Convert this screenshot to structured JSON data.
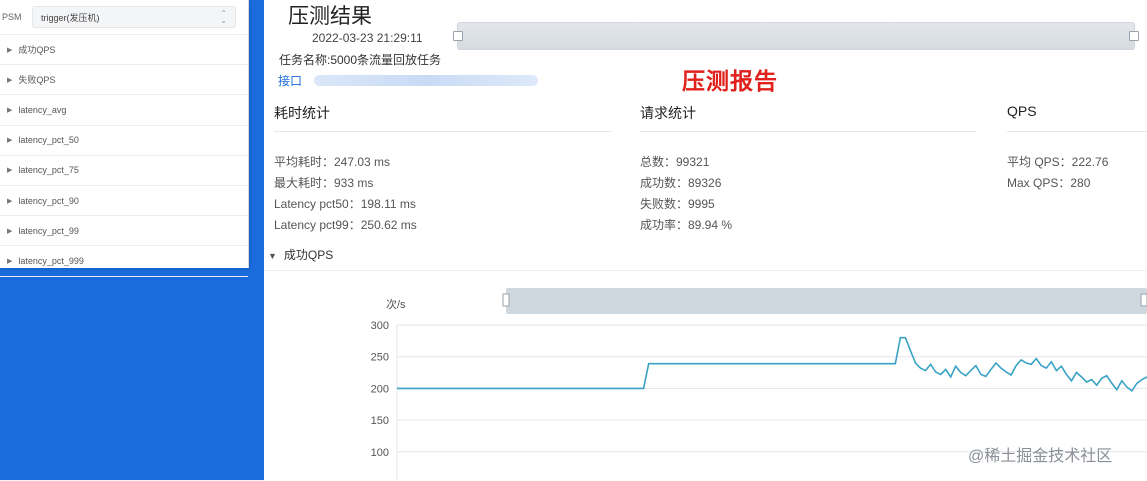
{
  "sidebar": {
    "psm_label": "PSM",
    "psm_value": "trigger(发压机)",
    "metrics": [
      "成功QPS",
      "失败QPS",
      "latency_avg",
      "latency_pct_50",
      "latency_pct_75",
      "latency_pct_90",
      "latency_pct_99",
      "latency_pct_999"
    ]
  },
  "header": {
    "title": "压测结果",
    "timestamp": "2022-03-23 21:29:11",
    "task_name": "任务名称:5000条流量回放任务",
    "interface_label": "接口"
  },
  "annotation": {
    "report_label": "压测报告",
    "color": "#e0201b"
  },
  "sections": {
    "latency": {
      "title": "耗时统计",
      "avg": "平均耗时：247.03 ms",
      "max": "最大耗时：933 ms",
      "pct50": "Latency pct50：198.11 ms",
      "pct99": "Latency pct99：250.62 ms"
    },
    "requests": {
      "title": "请求统计",
      "total": "总数：99321",
      "success": "成功数：89326",
      "fail": "失败数：9995",
      "rate": "成功率：89.94 %"
    },
    "qps": {
      "title": "QPS",
      "avg": "平均 QPS：222.76",
      "max": "Max QPS：280"
    }
  },
  "chart_section": {
    "title": "成功QPS"
  },
  "chart_data": {
    "type": "line",
    "ylabel": "次/s",
    "y_ticks": [
      "300",
      "250",
      "200",
      "150",
      "100"
    ],
    "ylim": [
      100,
      300
    ],
    "grid": true,
    "series_color": "#3aa3c5",
    "series": [
      {
        "values": [
          200,
          200,
          200,
          200,
          200,
          200,
          200,
          200,
          200,
          200,
          200,
          200,
          200,
          200,
          200,
          200,
          200,
          200,
          200,
          200,
          200,
          200,
          200,
          200,
          200,
          200,
          200,
          200,
          200,
          200,
          200,
          200,
          200,
          200,
          200,
          200,
          200,
          200,
          200,
          200,
          200,
          200,
          200,
          200,
          200,
          200,
          200,
          200,
          200,
          200,
          239,
          239,
          239,
          239,
          239,
          239,
          239,
          239,
          239,
          239,
          239,
          239,
          239,
          239,
          239,
          239,
          239,
          239,
          239,
          239,
          239,
          239,
          239,
          239,
          239,
          239,
          239,
          239,
          239,
          239,
          239,
          239,
          239,
          239,
          239,
          239,
          239,
          239,
          239,
          239,
          239,
          239,
          239,
          239,
          239,
          239,
          239,
          239,
          239,
          239,
          280,
          280,
          260,
          240,
          232,
          228,
          238,
          226,
          222,
          230,
          218,
          235,
          225,
          220,
          228,
          236,
          222,
          219,
          230,
          240,
          232,
          226,
          221,
          236,
          245,
          240,
          238,
          247,
          236,
          232,
          242,
          228,
          235,
          222,
          212,
          225,
          218,
          210,
          214,
          205,
          216,
          220,
          208,
          198,
          212,
          202,
          196,
          208,
          214,
          218
        ]
      }
    ]
  },
  "watermark": "@稀土掘金技术社区"
}
